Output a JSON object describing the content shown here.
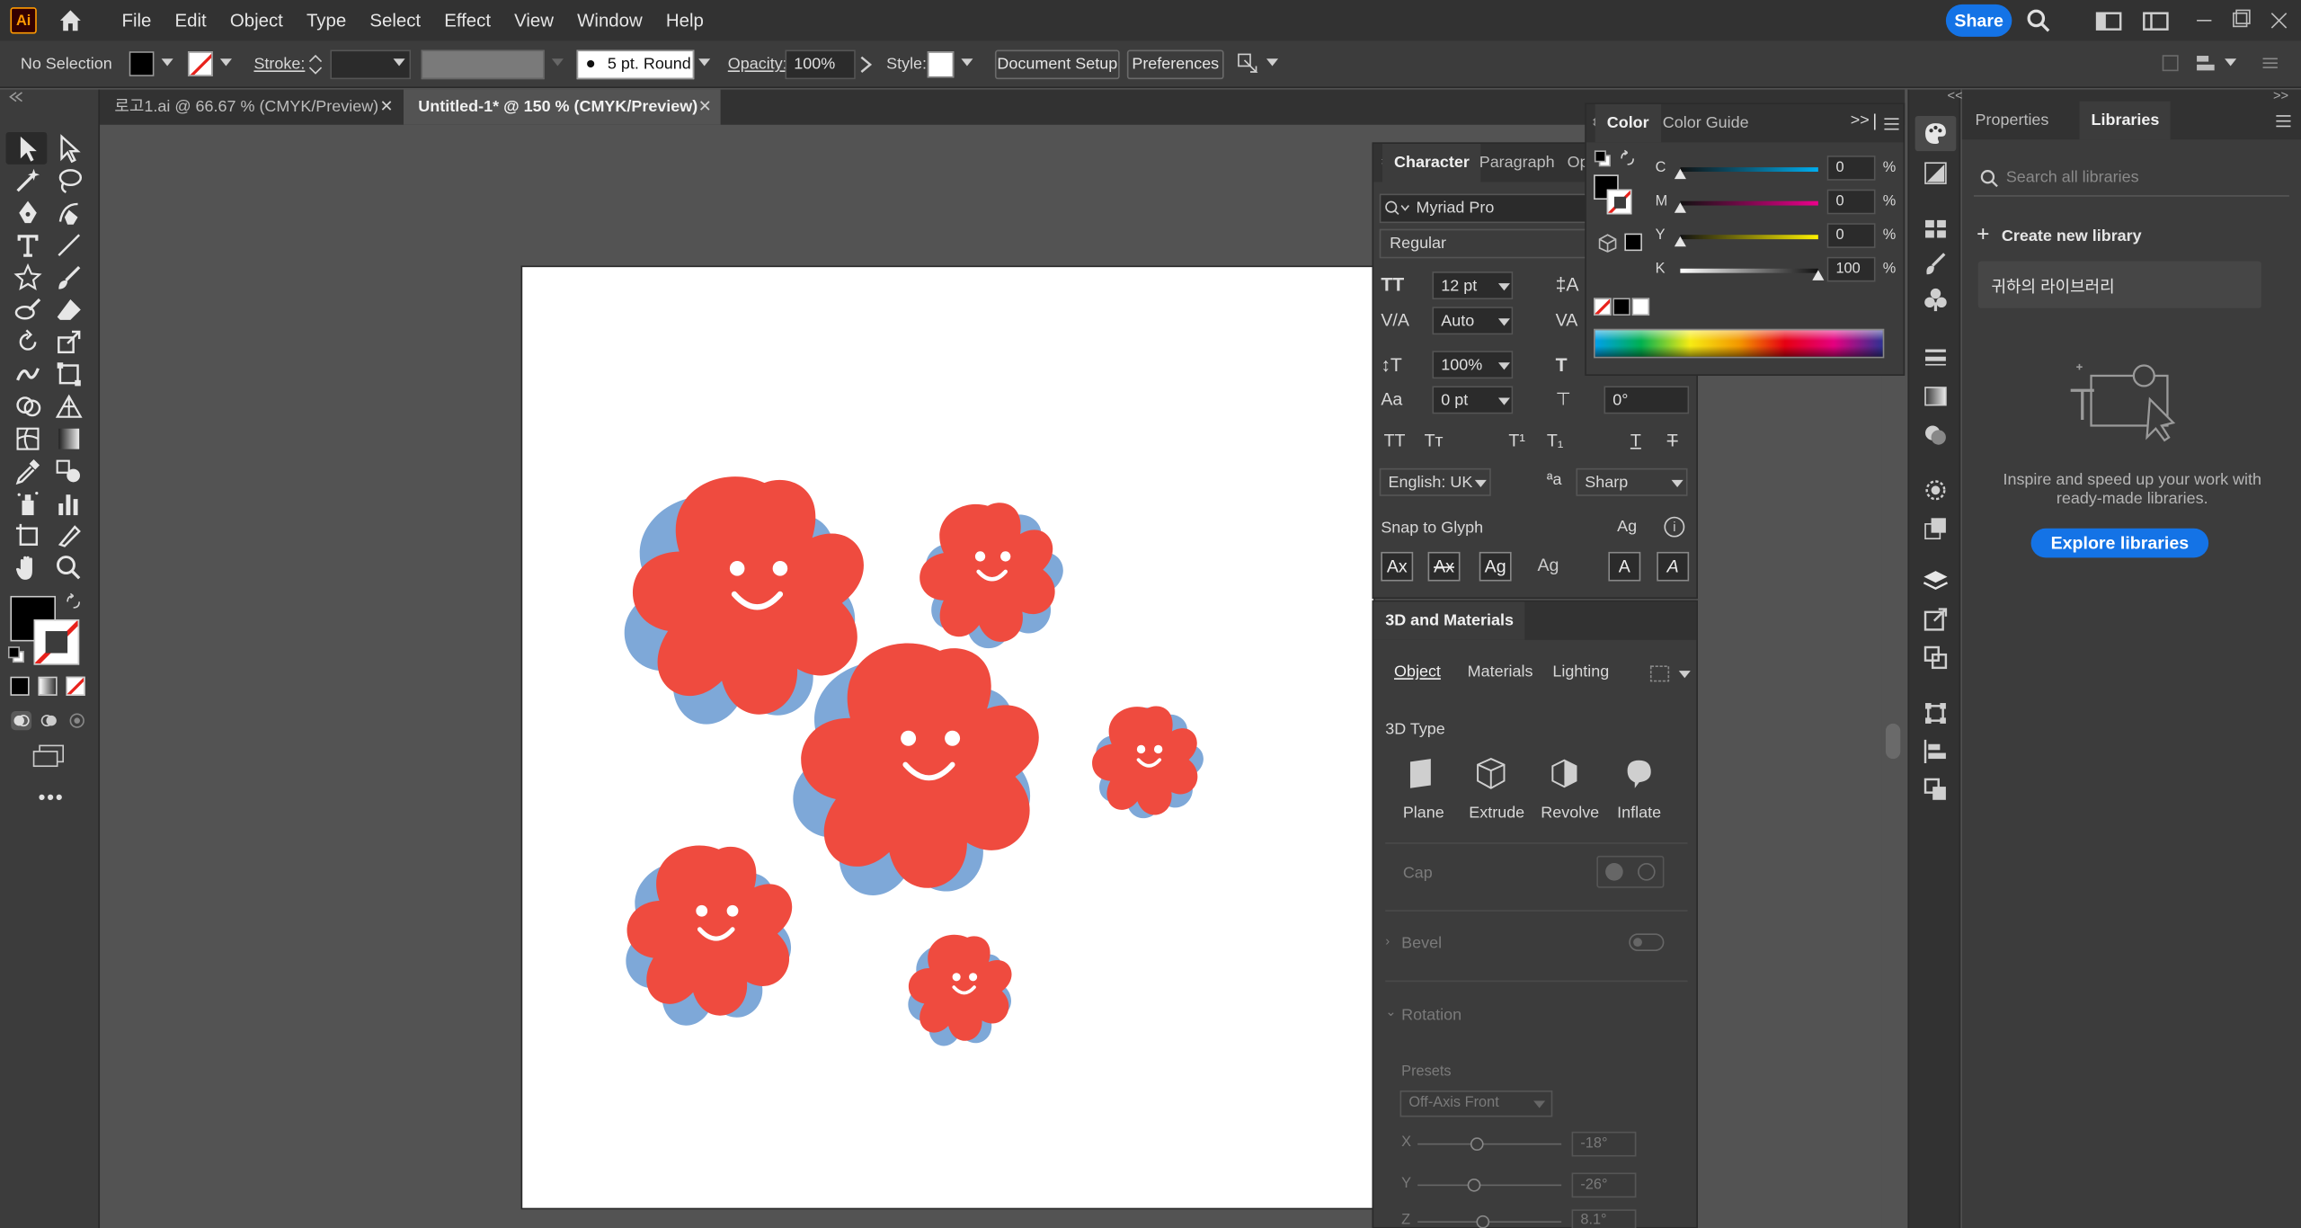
{
  "app": {
    "logo_text": "Ai"
  },
  "menu": [
    "File",
    "Edit",
    "Object",
    "Type",
    "Select",
    "Effect",
    "View",
    "Window",
    "Help"
  ],
  "share_label": "Share",
  "control": {
    "selection": "No Selection",
    "stroke_label": "Stroke:",
    "brush_label": "5 pt. Round",
    "opacity_label": "Opacity:",
    "opacity_value": "100%",
    "style_label": "Style:",
    "doc_setup": "Document Setup",
    "preferences": "Preferences"
  },
  "tabs": [
    {
      "label": "로고1.ai @ 66.67 % (CMYK/Preview)",
      "active": false
    },
    {
      "label": "Untitled-1* @ 150 % (CMYK/Preview)",
      "active": true
    }
  ],
  "character": {
    "tabs": [
      "Character",
      "Paragraph",
      "Op"
    ],
    "font": "Myriad Pro",
    "style": "Regular",
    "size": "12 pt",
    "kerning": "Auto",
    "scale": "100%",
    "baseline": "0 pt",
    "rotation": "0°",
    "language": "English: UK",
    "antialias": "Sharp",
    "snap_label": "Snap to Glyph"
  },
  "three_d": {
    "title": "3D and Materials",
    "tabs": [
      "Object",
      "Materials",
      "Lighting"
    ],
    "type_label": "3D Type",
    "types": [
      "Plane",
      "Extrude",
      "Revolve",
      "Inflate"
    ],
    "cap": "Cap",
    "bevel": "Bevel",
    "rotation": "Rotation",
    "presets": "Presets",
    "preset_value": "Off-Axis Front",
    "x_label": "X",
    "x_value": "-18°",
    "y_label": "Y",
    "y_value": "-26°",
    "z_label": "Z",
    "z_value": "8.1°"
  },
  "color": {
    "tabs": [
      "Color",
      "Color Guide"
    ],
    "channels": [
      {
        "label": "C",
        "value": "0",
        "fraction": 0
      },
      {
        "label": "M",
        "value": "0",
        "fraction": 0
      },
      {
        "label": "Y",
        "value": "0",
        "fraction": 0
      },
      {
        "label": "K",
        "value": "100",
        "fraction": 1
      }
    ],
    "pct": "%"
  },
  "libraries": {
    "tabs": [
      "Properties",
      "Libraries"
    ],
    "search_placeholder": "Search all libraries",
    "create": "Create new library",
    "library_name": "귀하의 라이브러리",
    "empty_text": "Inspire and speed up your work with ready-made libraries.",
    "explore": "Explore libraries"
  },
  "colors": {
    "flower_red": "#ef4b3f",
    "flower_blue": "#7ea8d8",
    "accent": "#1473e6"
  }
}
